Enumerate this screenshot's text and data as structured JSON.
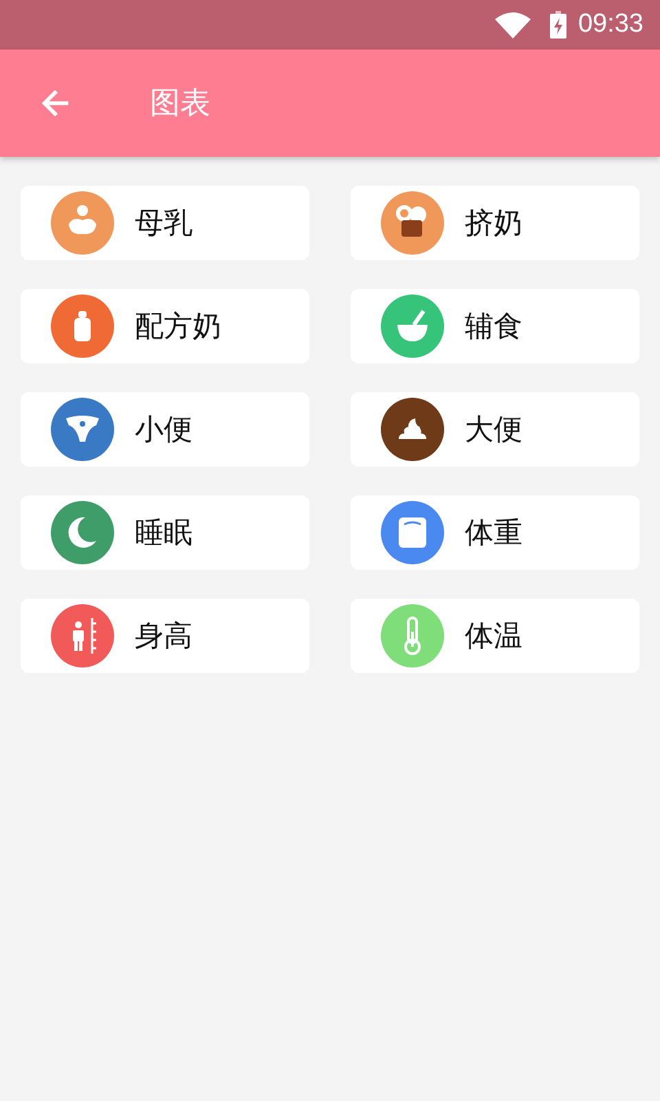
{
  "status_bar": {
    "time": "09:33"
  },
  "app_bar": {
    "title": "图表"
  },
  "items": [
    {
      "kind": "breast",
      "label": "母乳",
      "color": "#f0985a"
    },
    {
      "kind": "pump",
      "label": "挤奶",
      "color": "#f0985a"
    },
    {
      "kind": "bottle",
      "label": "配方奶",
      "color": "#ef6a35"
    },
    {
      "kind": "bowl",
      "label": "辅食",
      "color": "#36c37a"
    },
    {
      "kind": "diaper",
      "label": "小便",
      "color": "#3a7ac4"
    },
    {
      "kind": "poop",
      "label": "大便",
      "color": "#6e3a17"
    },
    {
      "kind": "moon",
      "label": "睡眠",
      "color": "#3e9d68"
    },
    {
      "kind": "scale",
      "label": "体重",
      "color": "#4a8af0"
    },
    {
      "kind": "height",
      "label": "身高",
      "color": "#f25a5a"
    },
    {
      "kind": "thermo",
      "label": "体温",
      "color": "#7fde7a"
    }
  ]
}
